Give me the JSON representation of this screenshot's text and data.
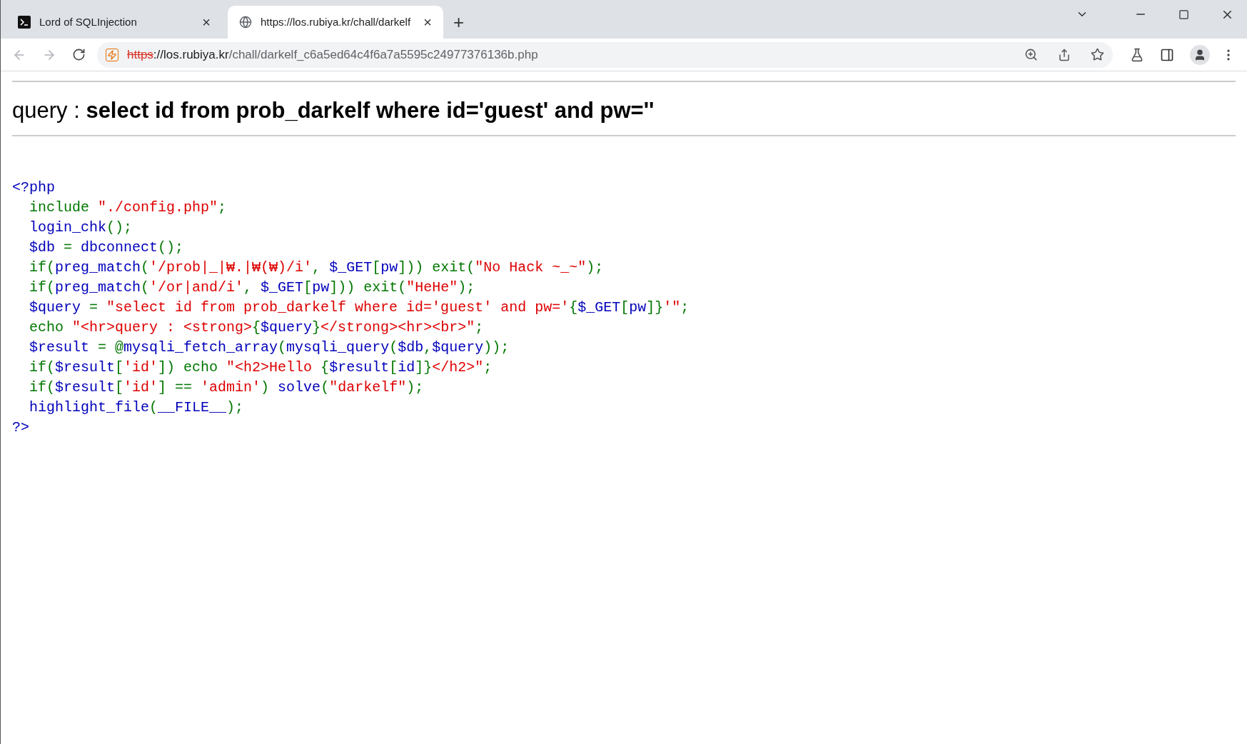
{
  "tabs": [
    {
      "title": "Lord of SQLInjection",
      "selected": false,
      "close": "×"
    },
    {
      "title": "https://los.rubiya.kr/chall/darkelf",
      "selected": true,
      "close": "×"
    }
  ],
  "new_tab": "+",
  "address_bar": {
    "scheme": "https",
    "host": "://los.rubiya.kr",
    "path": "/chall/darkelf_c6a5ed64c4f6a7a5595c24977376136b.php"
  },
  "page": {
    "query_label": "query : ",
    "query": "select id from prob_darkelf where id='guest' and pw=''",
    "code_lines": [
      [
        {
          "text": "<?php",
          "color": "#0000bb"
        }
      ],
      [
        {
          "text": "  include ",
          "color": "#007700"
        },
        {
          "text": "\"./config.php\"",
          "color": "#dd0000"
        },
        {
          "text": ";",
          "color": "#007700"
        }
      ],
      [
        {
          "text": "  login_chk",
          "color": "#0000bb"
        },
        {
          "text": "();",
          "color": "#007700"
        }
      ],
      [
        {
          "text": "  $db ",
          "color": "#0000bb"
        },
        {
          "text": "= ",
          "color": "#007700"
        },
        {
          "text": "dbconnect",
          "color": "#0000bb"
        },
        {
          "text": "();",
          "color": "#007700"
        }
      ],
      [
        {
          "text": "  if(",
          "color": "#007700"
        },
        {
          "text": "preg_match",
          "color": "#0000bb"
        },
        {
          "text": "(",
          "color": "#007700"
        },
        {
          "text": "'/prob|_|₩.|₩(₩)/i'",
          "color": "#dd0000"
        },
        {
          "text": ", ",
          "color": "#007700"
        },
        {
          "text": "$_GET",
          "color": "#0000bb"
        },
        {
          "text": "[",
          "color": "#007700"
        },
        {
          "text": "pw",
          "color": "#0000bb"
        },
        {
          "text": "])) exit(",
          "color": "#007700"
        },
        {
          "text": "\"No Hack ~_~\"",
          "color": "#dd0000"
        },
        {
          "text": ");",
          "color": "#007700"
        }
      ],
      [
        {
          "text": "  if(",
          "color": "#007700"
        },
        {
          "text": "preg_match",
          "color": "#0000bb"
        },
        {
          "text": "(",
          "color": "#007700"
        },
        {
          "text": "'/or|and/i'",
          "color": "#dd0000"
        },
        {
          "text": ", ",
          "color": "#007700"
        },
        {
          "text": "$_GET",
          "color": "#0000bb"
        },
        {
          "text": "[",
          "color": "#007700"
        },
        {
          "text": "pw",
          "color": "#0000bb"
        },
        {
          "text": "])) exit(",
          "color": "#007700"
        },
        {
          "text": "\"HeHe\"",
          "color": "#dd0000"
        },
        {
          "text": ");",
          "color": "#007700"
        }
      ],
      [
        {
          "text": "  $query ",
          "color": "#0000bb"
        },
        {
          "text": "= ",
          "color": "#007700"
        },
        {
          "text": "\"select id from prob_darkelf where id='guest' and pw='",
          "color": "#dd0000"
        },
        {
          "text": "{",
          "color": "#007700"
        },
        {
          "text": "$_GET",
          "color": "#0000bb"
        },
        {
          "text": "[",
          "color": "#007700"
        },
        {
          "text": "pw",
          "color": "#0000bb"
        },
        {
          "text": "]}",
          "color": "#007700"
        },
        {
          "text": "'\"",
          "color": "#dd0000"
        },
        {
          "text": ";",
          "color": "#007700"
        }
      ],
      [
        {
          "text": "  echo ",
          "color": "#007700"
        },
        {
          "text": "\"<hr>query : <strong>",
          "color": "#dd0000"
        },
        {
          "text": "{",
          "color": "#007700"
        },
        {
          "text": "$query",
          "color": "#0000bb"
        },
        {
          "text": "}",
          "color": "#007700"
        },
        {
          "text": "</strong><hr><br>\"",
          "color": "#dd0000"
        },
        {
          "text": ";",
          "color": "#007700"
        }
      ],
      [
        {
          "text": "  $result ",
          "color": "#0000bb"
        },
        {
          "text": "= @",
          "color": "#007700"
        },
        {
          "text": "mysqli_fetch_array",
          "color": "#0000bb"
        },
        {
          "text": "(",
          "color": "#007700"
        },
        {
          "text": "mysqli_query",
          "color": "#0000bb"
        },
        {
          "text": "(",
          "color": "#007700"
        },
        {
          "text": "$db",
          "color": "#0000bb"
        },
        {
          "text": ",",
          "color": "#007700"
        },
        {
          "text": "$query",
          "color": "#0000bb"
        },
        {
          "text": "));",
          "color": "#007700"
        }
      ],
      [
        {
          "text": "  if(",
          "color": "#007700"
        },
        {
          "text": "$result",
          "color": "#0000bb"
        },
        {
          "text": "[",
          "color": "#007700"
        },
        {
          "text": "'id'",
          "color": "#dd0000"
        },
        {
          "text": "]) echo ",
          "color": "#007700"
        },
        {
          "text": "\"<h2>Hello ",
          "color": "#dd0000"
        },
        {
          "text": "{",
          "color": "#007700"
        },
        {
          "text": "$result",
          "color": "#0000bb"
        },
        {
          "text": "[",
          "color": "#007700"
        },
        {
          "text": "id",
          "color": "#0000bb"
        },
        {
          "text": "]}",
          "color": "#007700"
        },
        {
          "text": "</h2>\"",
          "color": "#dd0000"
        },
        {
          "text": ";",
          "color": "#007700"
        }
      ],
      [
        {
          "text": "  if(",
          "color": "#007700"
        },
        {
          "text": "$result",
          "color": "#0000bb"
        },
        {
          "text": "[",
          "color": "#007700"
        },
        {
          "text": "'id'",
          "color": "#dd0000"
        },
        {
          "text": "] == ",
          "color": "#007700"
        },
        {
          "text": "'admin'",
          "color": "#dd0000"
        },
        {
          "text": ") ",
          "color": "#007700"
        },
        {
          "text": "solve",
          "color": "#0000bb"
        },
        {
          "text": "(",
          "color": "#007700"
        },
        {
          "text": "\"darkelf\"",
          "color": "#dd0000"
        },
        {
          "text": ");",
          "color": "#007700"
        }
      ],
      [
        {
          "text": "  highlight_file",
          "color": "#0000bb"
        },
        {
          "text": "(",
          "color": "#007700"
        },
        {
          "text": "__FILE__",
          "color": "#0000bb"
        },
        {
          "text": ");",
          "color": "#007700"
        }
      ],
      [
        {
          "text": "?>",
          "color": "#0000bb"
        }
      ]
    ]
  }
}
